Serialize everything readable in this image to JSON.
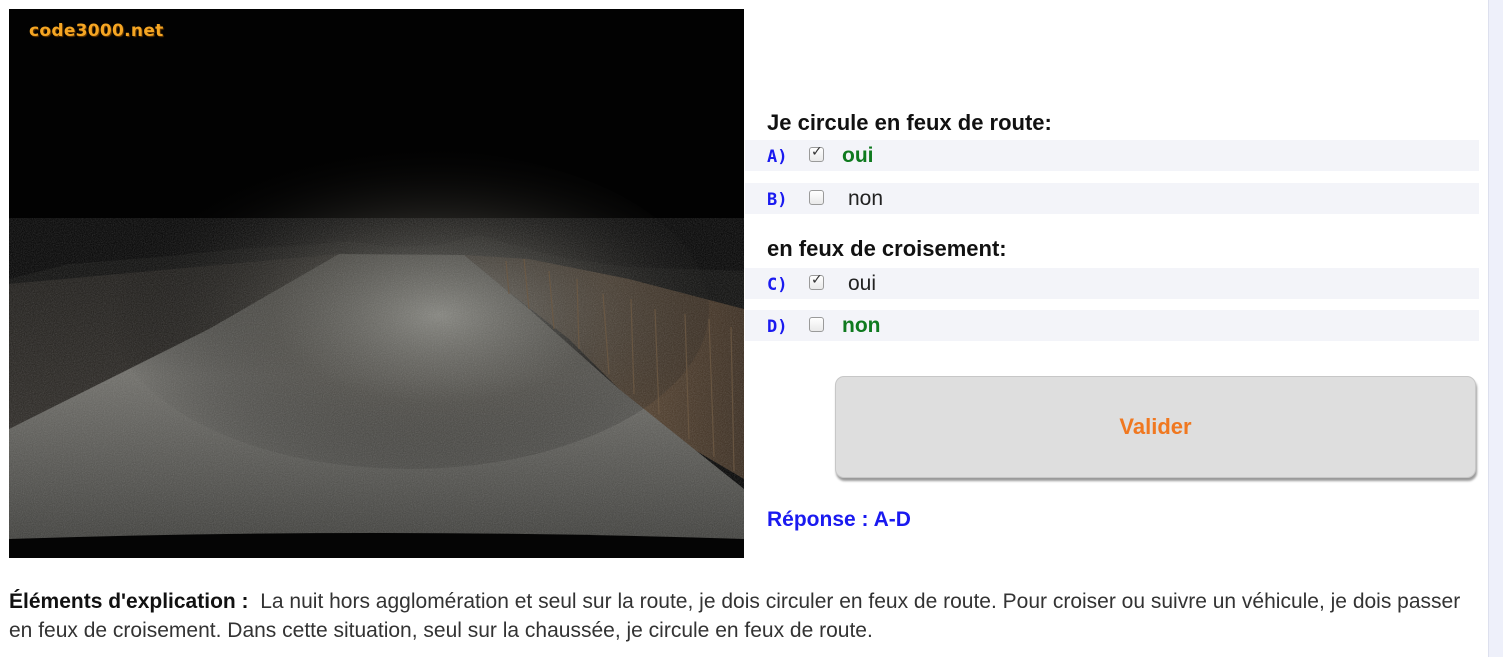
{
  "image": {
    "watermark": "code3000.net",
    "description_icon": "night-road-photo"
  },
  "question1": {
    "title": "Je circule en feux de route:",
    "answers": [
      {
        "letter": "A)",
        "text": "oui",
        "checked": true,
        "correct": true
      },
      {
        "letter": "B)",
        "text": "non",
        "checked": false,
        "correct": false
      }
    ]
  },
  "question2": {
    "title": "en feux de croisement:",
    "answers": [
      {
        "letter": "C)",
        "text": "oui",
        "checked": true,
        "correct": false
      },
      {
        "letter": "D)",
        "text": "non",
        "checked": false,
        "correct": true
      }
    ]
  },
  "validate_button": {
    "label": "Valider"
  },
  "answer_key": "Réponse : A-D",
  "explanation": {
    "label": "Éléments d'explication :",
    "text": "La nuit hors agglomération et seul sur la route, je dois circuler en feux de route. Pour croiser ou suivre un véhicule, je dois passer en feux de croisement. Dans cette situation, seul sur la chaussée, je circule en feux de route."
  },
  "colors": {
    "correct_answer": "#0f7a1f",
    "letter": "#1a1af0",
    "button_text": "#f07820",
    "watermark": "#f5a623"
  }
}
